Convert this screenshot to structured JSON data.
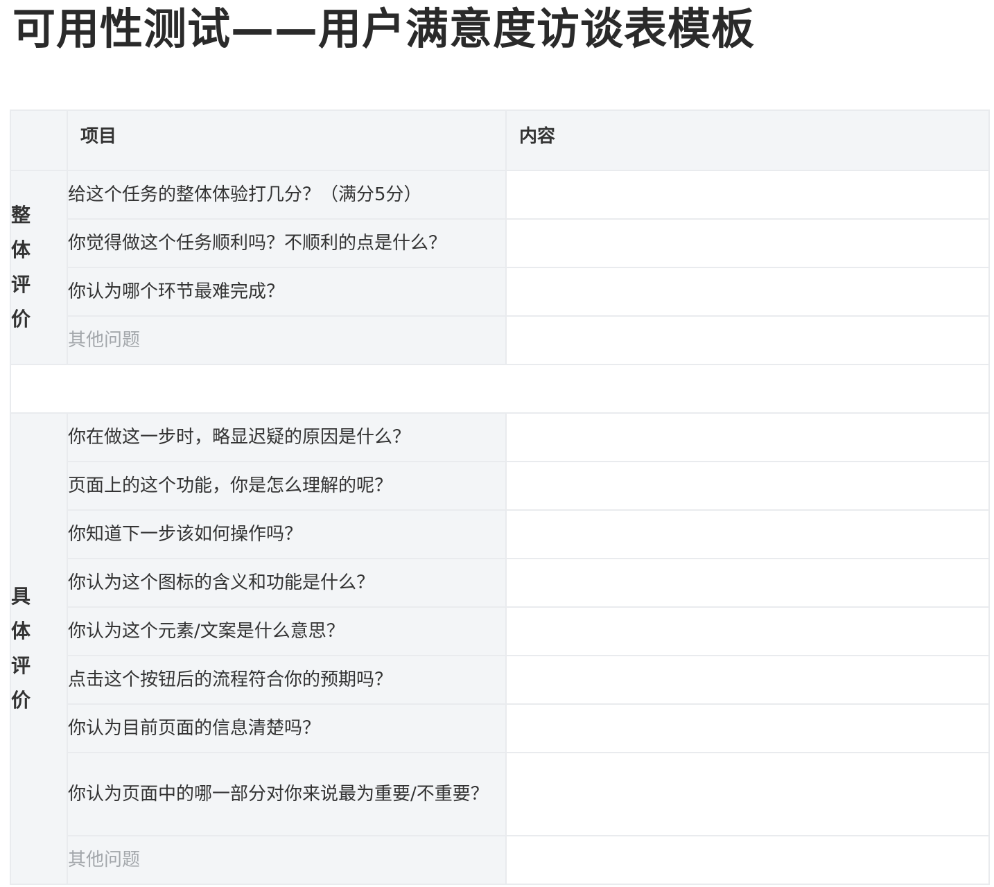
{
  "page": {
    "title": "可用性测试——用户满意度访谈表模板"
  },
  "table": {
    "headers": {
      "category": "",
      "item": "项目",
      "content": "内容"
    },
    "sections": [
      {
        "category": "整体评价",
        "category_chars": [
          "整",
          "体",
          "评",
          "价"
        ],
        "rows": [
          {
            "item": "给这个任务的整体体验打几分？（满分5分）",
            "content": ""
          },
          {
            "item": "你觉得做这个任务顺利吗？不顺利的点是什么？",
            "content": ""
          },
          {
            "item": "你认为哪个环节最难完成？",
            "content": ""
          },
          {
            "item": "其他问题",
            "content": "",
            "placeholder": true
          }
        ]
      },
      {
        "category": "具体评价",
        "category_chars": [
          "具",
          "体",
          "评",
          "价"
        ],
        "rows": [
          {
            "item": "你在做这一步时，略显迟疑的原因是什么？",
            "content": ""
          },
          {
            "item": "页面上的这个功能，你是怎么理解的呢？",
            "content": ""
          },
          {
            "item": "你知道下一步该如何操作吗？",
            "content": ""
          },
          {
            "item": "你认为这个图标的含义和功能是什么？",
            "content": ""
          },
          {
            "item": "你认为这个元素/文案是什么意思？",
            "content": ""
          },
          {
            "item": "点击这个按钮后的流程符合你的预期吗？",
            "content": ""
          },
          {
            "item": "你认为目前页面的信息清楚吗？",
            "content": ""
          },
          {
            "item": "你认为页面中的哪一部分对你来说最为重要/不重要？",
            "content": ""
          },
          {
            "item": "其他问题",
            "content": "",
            "placeholder": true
          }
        ]
      }
    ]
  }
}
